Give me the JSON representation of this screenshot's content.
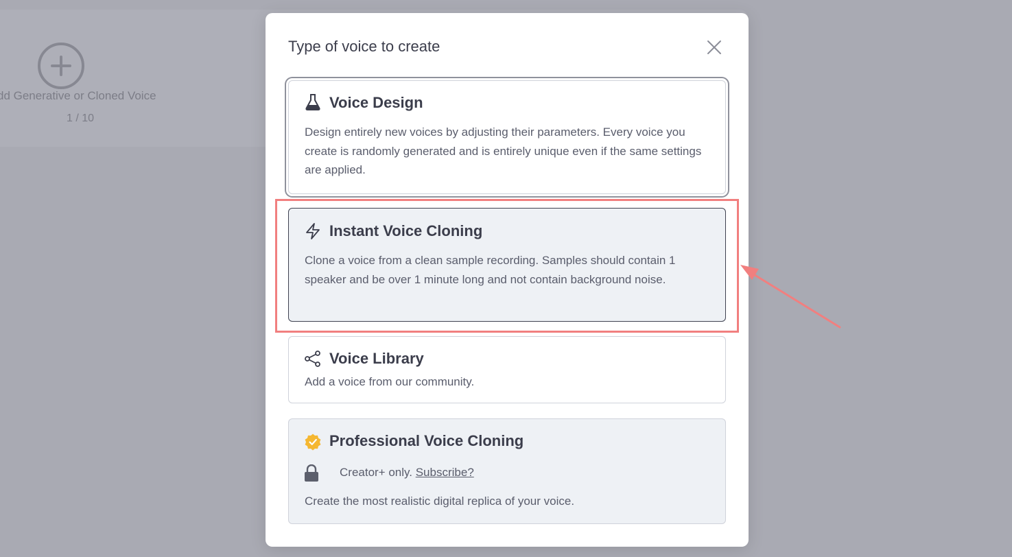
{
  "background": {
    "add_voice_label": "dd Generative or Cloned Voice",
    "voice_count": "1 / 10"
  },
  "modal": {
    "title": "Type of voice to create",
    "options": [
      {
        "title": "Voice Design",
        "icon": "flask-icon",
        "description": "Design entirely new voices by adjusting their parameters. Every voice you create is randomly generated and is entirely unique even if the same settings are applied."
      },
      {
        "title": "Instant Voice Cloning",
        "icon": "lightning-icon",
        "description": "Clone a voice from a clean sample recording. Samples should contain 1 speaker and be over 1 minute long and not contain background noise."
      },
      {
        "title": "Voice Library",
        "icon": "share-icon",
        "description": "Add a voice from our community."
      },
      {
        "title": "Professional Voice Cloning",
        "icon": "verified-badge-icon",
        "lock_text": "Creator+ only. ",
        "subscribe_link": "Subscribe?",
        "description": "Create the most realistic digital replica of your voice."
      }
    ]
  },
  "colors": {
    "highlight": "#f17f7f",
    "badge": "#f5b731",
    "text": "#3b3d4b"
  }
}
